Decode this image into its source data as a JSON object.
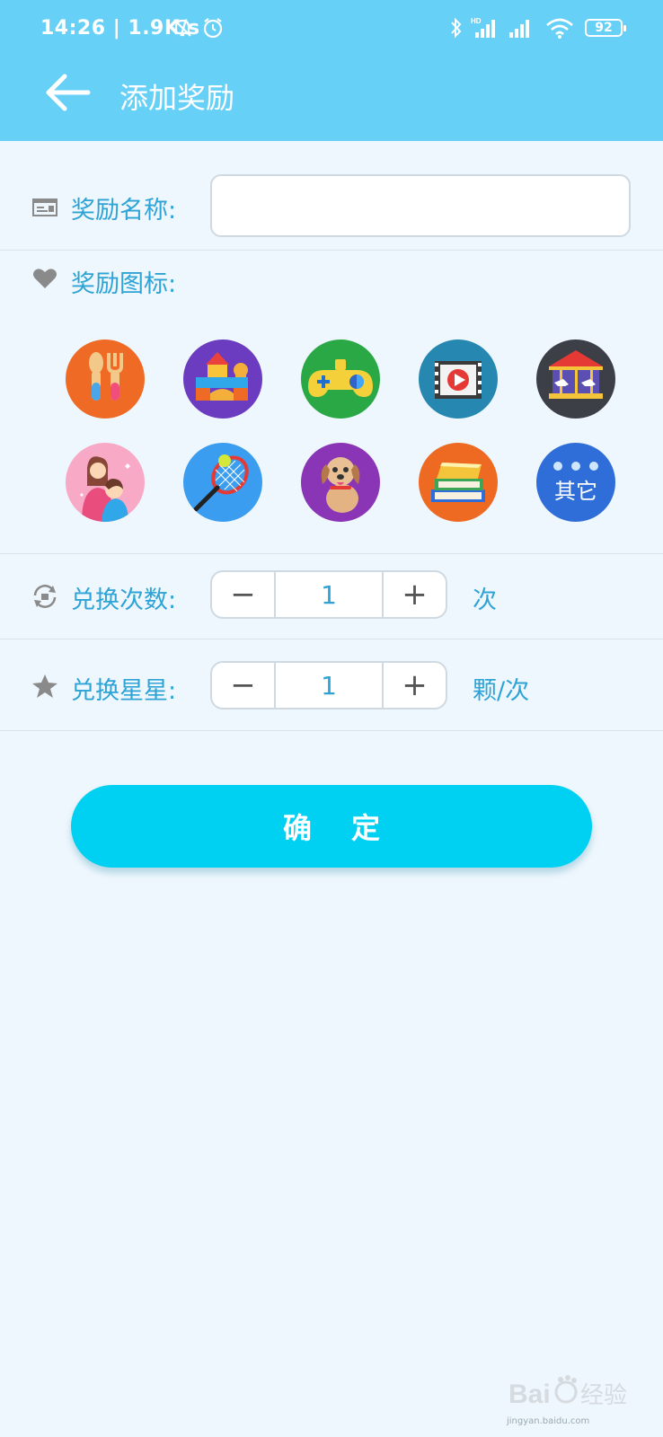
{
  "status_bar": {
    "time": "14:26 | 1.9K/s",
    "battery": "92",
    "icons": [
      "mute-bell-icon",
      "alarm-icon",
      "bluetooth-icon",
      "hd-signal-icon",
      "signal-icon",
      "wifi-icon",
      "battery-icon"
    ]
  },
  "header": {
    "title": "添加奖励",
    "back_icon": "arrow-left-icon",
    "background": "#66d0f7"
  },
  "form": {
    "name": {
      "label": "奖励名称:",
      "value": "",
      "placeholder": "",
      "icon": "card-icon"
    },
    "icon": {
      "label": "奖励图标:",
      "icon": "heart-icon"
    },
    "reward_icons": [
      {
        "name": "food",
        "icon": "spoon-fork-icon",
        "color": "#ef6a25"
      },
      {
        "name": "toys",
        "icon": "building-blocks-icon",
        "color": "#6b3cc0"
      },
      {
        "name": "game",
        "icon": "gamepad-icon",
        "color": "#2aa845"
      },
      {
        "name": "video",
        "icon": "video-play-icon",
        "color": "#2687b0"
      },
      {
        "name": "amusement",
        "icon": "carousel-icon",
        "color": "#3c3f45"
      },
      {
        "name": "hug",
        "icon": "mother-child-icon",
        "color": "#f7a9c6"
      },
      {
        "name": "sports",
        "icon": "tennis-racket-icon",
        "color": "#3b9df0"
      },
      {
        "name": "pet",
        "icon": "puppy-icon",
        "color": "#8a35b5"
      },
      {
        "name": "books",
        "icon": "books-icon",
        "color": "#ee6a23"
      },
      {
        "name": "other",
        "label": "其它",
        "icon": "other-icon",
        "color": "#2f6ed8"
      }
    ],
    "times": {
      "label": "兑换次数:",
      "value": "1",
      "unit": "次",
      "minus": "−",
      "plus": "+",
      "icon": "refresh-gift-icon"
    },
    "stars": {
      "label": "兑换星星:",
      "value": "1",
      "unit": "颗/次",
      "minus": "−",
      "plus": "+",
      "icon": "star-icon"
    }
  },
  "confirm_button": {
    "label": "确定",
    "color": "#00d0f2"
  },
  "watermark": {
    "text": "Bai经验",
    "subtext": "jingyan.baidu.com"
  }
}
